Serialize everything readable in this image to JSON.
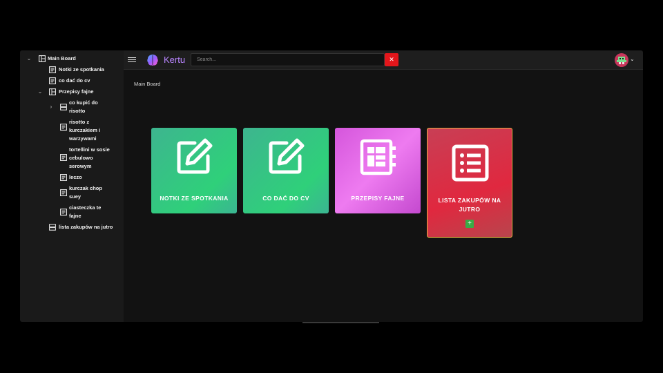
{
  "sidebar": {
    "items": [
      {
        "label": "Main Board",
        "icon": "board-icon",
        "expanded": true
      },
      {
        "label": "Notki ze spotkania",
        "icon": "document-icon"
      },
      {
        "label": "co dać do cv",
        "icon": "document-icon"
      },
      {
        "label": "Przepisy fajne",
        "icon": "board-icon",
        "expanded": true
      },
      {
        "label_lines": [
          "co kupić do",
          "risotto"
        ],
        "icon": "list-icon",
        "collapsed": true
      },
      {
        "label_lines": [
          "risotto z",
          "kurczakiem i",
          "warzywami"
        ],
        "icon": "document-icon"
      },
      {
        "label_lines": [
          "tortellini w sosie",
          "cebulowo",
          "serowym"
        ],
        "icon": "document-icon"
      },
      {
        "label": "leczo",
        "icon": "document-icon"
      },
      {
        "label_lines": [
          "kurczak chop",
          "suey"
        ],
        "icon": "document-icon"
      },
      {
        "label_lines": [
          "ciasteczka te",
          "fajne"
        ],
        "icon": "document-icon"
      },
      {
        "label": "lista zakupów na jutro",
        "icon": "list-icon"
      }
    ]
  },
  "header": {
    "brand": "Kertu",
    "search_placeholder": "Search...",
    "clear_label": "✕"
  },
  "main": {
    "breadcrumb": "Main Board",
    "cards": [
      {
        "label": "NOTKI ZE SPOTKANIA",
        "icon": "edit-icon",
        "color": "#2fd07a"
      },
      {
        "label": "CO DAĆ DO CV",
        "icon": "edit-icon",
        "color": "#2fd07a"
      },
      {
        "label": "PRZEPISY FAJNE",
        "icon": "notebook-board-icon",
        "color": "#ee7bf0"
      },
      {
        "label_lines": [
          "LISTA ZAKUPÓW NA",
          "JUTRO"
        ],
        "icon": "list-icon",
        "color": "#e0283f",
        "add_label": "+"
      }
    ]
  },
  "colors": {
    "accent": "#b985ff",
    "danger": "#e3161b",
    "highlight_border": "#e8b543",
    "add": "#3aab46"
  }
}
